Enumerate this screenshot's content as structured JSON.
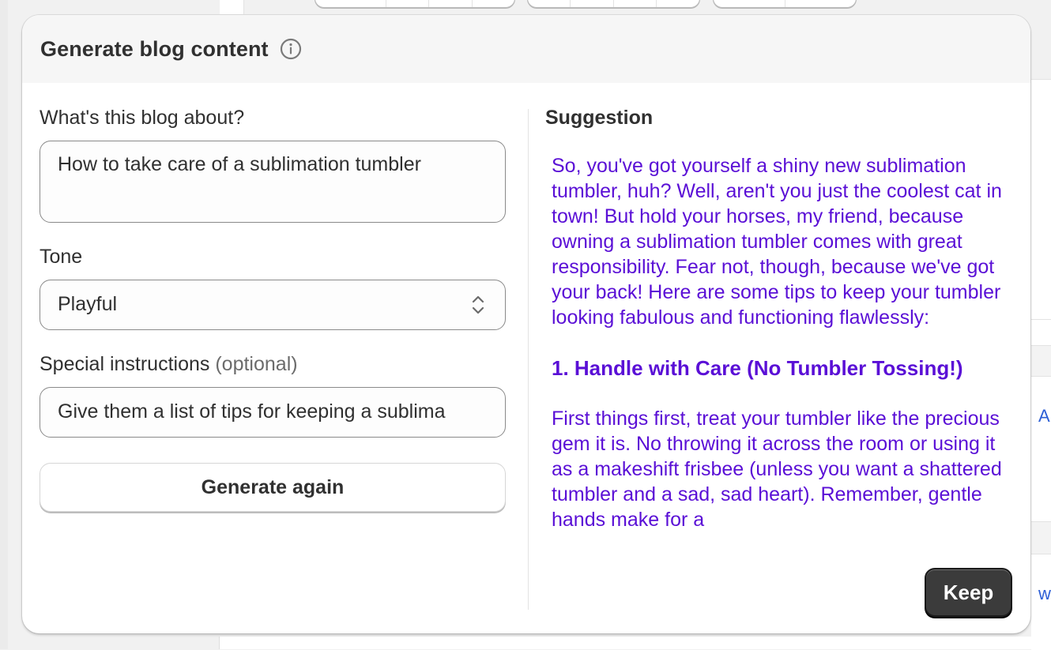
{
  "modal": {
    "title": "Generate blog content",
    "info_icon": "info-circle-icon"
  },
  "form": {
    "topic_label": "What's this blog about?",
    "topic_value": "How to take care of a sublimation tumbler",
    "tone_label": "Tone",
    "tone_value": "Playful",
    "tone_icon": "select-chevron-updown-icon",
    "instructions_label": "Special instructions",
    "instructions_optional": "(optional)",
    "instructions_value": "Give them a list of tips for keeping a sublima",
    "generate_again_label": "Generate again"
  },
  "suggestion": {
    "label": "Suggestion",
    "intro": "So, you've got yourself a shiny new sublimation tumbler, huh? Well, aren't you just the coolest cat in town! But hold your horses, my friend, because owning a sublimation tumbler comes with great responsibility. Fear not, though, because we've got your back! Here are some tips to keep your tumbler looking fabulous and functioning flawlessly:",
    "heading_1": "1. Handle with Care (No Tumbler Tossing!)",
    "paragraph_1": "First things first, treat your tumbler like the precious gem it is. No throwing it across the room or using it as a makeshift frisbee (unless you want a shattered tumbler and a sad, sad heart). Remember, gentle hands make for a",
    "text_color": "#5a0fd6"
  },
  "actions": {
    "keep_label": "Keep"
  },
  "background": {
    "right_letters": [
      "A",
      "w"
    ]
  }
}
